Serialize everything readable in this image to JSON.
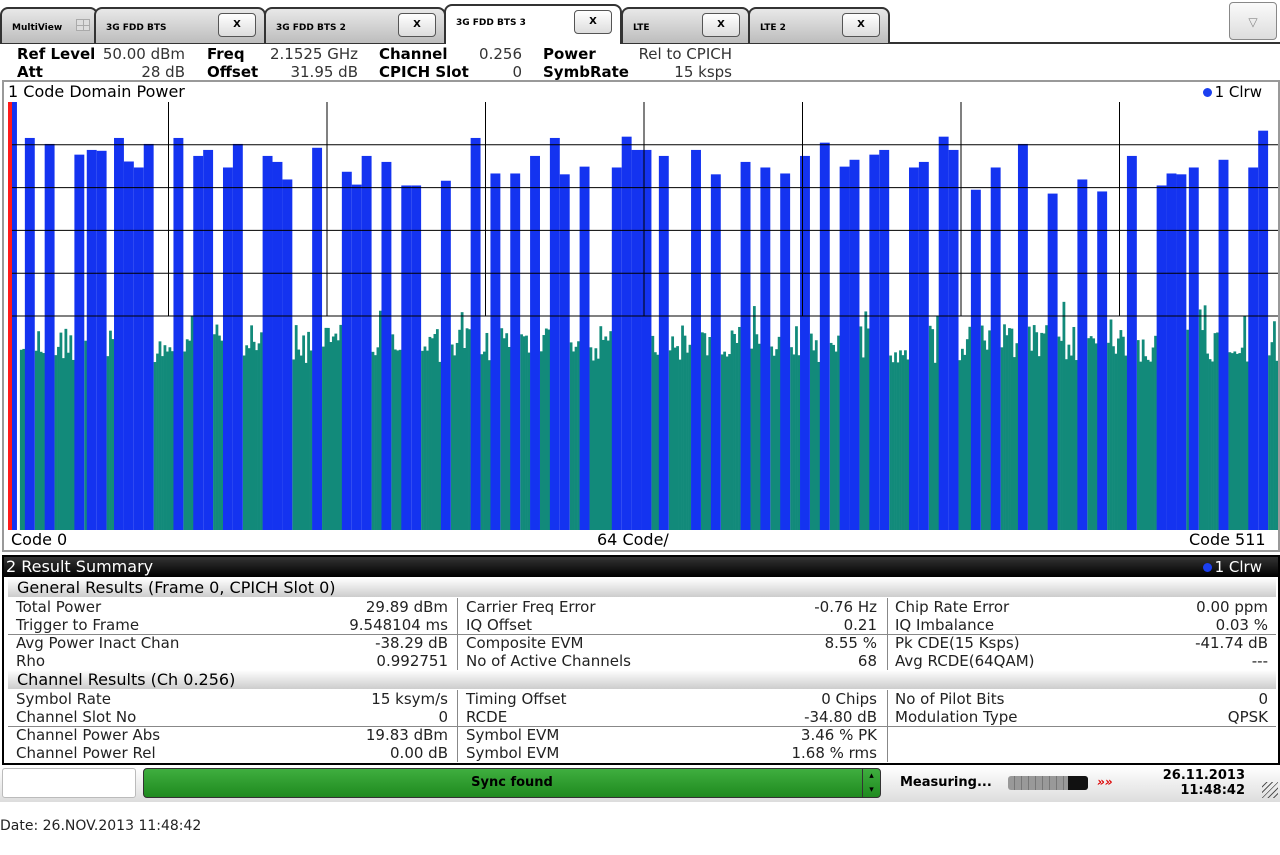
{
  "tabs": [
    {
      "label": "MultiView",
      "icon": "multiview-grid-icon",
      "close": ""
    },
    {
      "label": "3G FDD BTS",
      "close": "X"
    },
    {
      "label": "3G FDD BTS 2",
      "close": "X"
    },
    {
      "label": "3G FDD BTS 3",
      "close": "X",
      "active": true
    },
    {
      "label": "LTE",
      "close": "X"
    },
    {
      "label": "LTE 2",
      "close": "X"
    }
  ],
  "menu_icon": "▽",
  "header": {
    "ref_level_label": "Ref Level",
    "ref_level": "50.00 dBm",
    "att_label": "Att",
    "att": "28 dB",
    "freq_label": "Freq",
    "freq": "2.1525 GHz",
    "offset_label": "Offset",
    "offset": "31.95 dB",
    "channel_label": "Channel",
    "channel": "0.256",
    "cpich_label": "CPICH Slot",
    "cpich": "0",
    "power_label": "Power",
    "power": "Rel to CPICH",
    "symbrate_label": "SymbRate",
    "symbrate": "15 ksps"
  },
  "panel1": {
    "title": "1 Code Domain Power",
    "trace": "1 Clrw",
    "x_left": "Code 0",
    "x_center": "64 Code/",
    "x_right": "Code 511"
  },
  "chart_data": {
    "type": "bar",
    "xlabel": "64 Code/",
    "xlim": [
      0,
      511
    ],
    "ylim": [
      -100,
      0
    ],
    "grid": true,
    "colors": {
      "active": "#1433f0",
      "inactive": "#128a7a",
      "selected": "#ff1a1a"
    },
    "active_channels": [
      {
        "code": 0,
        "db": 0
      },
      {
        "code": 6,
        "db": -8.4
      },
      {
        "code": 14,
        "db": -9.8
      },
      {
        "code": 26,
        "db": -12.3
      },
      {
        "code": 31,
        "db": -11.2
      },
      {
        "code": 35,
        "db": -11.4
      },
      {
        "code": 42,
        "db": -8.4
      },
      {
        "code": 46,
        "db": -13.9
      },
      {
        "code": 50,
        "db": -15.3
      },
      {
        "code": 54,
        "db": -9.8
      },
      {
        "code": 66,
        "db": -8.4
      },
      {
        "code": 74,
        "db": -12.6
      },
      {
        "code": 78,
        "db": -11.2
      },
      {
        "code": 86,
        "db": -15.3
      },
      {
        "code": 90,
        "db": -9.8
      },
      {
        "code": 102,
        "db": -12.6
      },
      {
        "code": 106,
        "db": -14.0
      },
      {
        "code": 110,
        "db": -18.1
      },
      {
        "code": 122,
        "db": -10.7
      },
      {
        "code": 134,
        "db": -16.3
      },
      {
        "code": 138,
        "db": -19.3
      },
      {
        "code": 142,
        "db": -12.6
      },
      {
        "code": 150,
        "db": -14.0
      },
      {
        "code": 158,
        "db": -19.5
      },
      {
        "code": 162,
        "db": -19.5
      },
      {
        "code": 174,
        "db": -18.4
      },
      {
        "code": 186,
        "db": -8.4
      },
      {
        "code": 194,
        "db": -16.7
      },
      {
        "code": 202,
        "db": -16.7
      },
      {
        "code": 210,
        "db": -12.6
      },
      {
        "code": 218,
        "db": -8.4
      },
      {
        "code": 222,
        "db": -16.9
      },
      {
        "code": 230,
        "db": -15.1
      },
      {
        "code": 243,
        "db": -15.3
      },
      {
        "code": 247,
        "db": -8.1
      },
      {
        "code": 251,
        "db": -11.2
      },
      {
        "code": 255,
        "db": -11.2
      },
      {
        "code": 262,
        "db": -12.6
      },
      {
        "code": 275,
        "db": -11.2
      },
      {
        "code": 283,
        "db": -16.9
      },
      {
        "code": 295,
        "db": -14.0
      },
      {
        "code": 303,
        "db": -15.3
      },
      {
        "code": 311,
        "db": -16.7
      },
      {
        "code": 319,
        "db": -12.6
      },
      {
        "code": 327,
        "db": -9.5
      },
      {
        "code": 335,
        "db": -15.1
      },
      {
        "code": 339,
        "db": -13.5
      },
      {
        "code": 347,
        "db": -12.3
      },
      {
        "code": 351,
        "db": -11.2
      },
      {
        "code": 363,
        "db": -15.3
      },
      {
        "code": 367,
        "db": -14.0
      },
      {
        "code": 375,
        "db": -8.1
      },
      {
        "code": 379,
        "db": -11.2
      },
      {
        "code": 388,
        "db": -20.5
      },
      {
        "code": 396,
        "db": -15.3
      },
      {
        "code": 407,
        "db": -9.8
      },
      {
        "code": 419,
        "db": -21.4
      },
      {
        "code": 431,
        "db": -18.1
      },
      {
        "code": 439,
        "db": -20.9
      },
      {
        "code": 451,
        "db": -12.6
      },
      {
        "code": 463,
        "db": -19.5
      },
      {
        "code": 467,
        "db": -16.7
      },
      {
        "code": 471,
        "db": -16.9
      },
      {
        "code": 476,
        "db": -15.3
      },
      {
        "code": 488,
        "db": -13.5
      },
      {
        "code": 500,
        "db": -15.3
      },
      {
        "code": 504,
        "db": -6.7
      }
    ]
  },
  "panel2": {
    "title": "2 Result Summary",
    "trace": "1 Clrw",
    "general_title": "General Results (Frame 0, CPICH Slot 0)",
    "general_rows": [
      [
        [
          "Total Power",
          "29.89 dBm"
        ],
        [
          "Carrier Freq Error",
          "-0.76 Hz"
        ],
        [
          "Chip Rate Error",
          "0.00 ppm"
        ]
      ],
      [
        [
          "Trigger to Frame",
          "9.548104 ms"
        ],
        [
          "IQ Offset",
          "0.21"
        ],
        [
          "IQ Imbalance",
          "0.03 %"
        ]
      ],
      [
        [
          "Avg Power Inact Chan",
          "-38.29 dB"
        ],
        [
          "Composite EVM",
          "8.55 %"
        ],
        [
          "Pk CDE(15 Ksps)",
          "-41.74 dB"
        ]
      ],
      [
        [
          "Rho",
          "0.992751"
        ],
        [
          "No of Active Channels",
          "68"
        ],
        [
          "Avg RCDE(64QAM)",
          "---"
        ]
      ]
    ],
    "channel_title": "Channel Results (Ch 0.256)",
    "channel_rows": [
      [
        [
          "Symbol Rate",
          "15 ksym/s"
        ],
        [
          "Timing Offset",
          "0 Chips"
        ],
        [
          "No of Pilot Bits",
          "0"
        ]
      ],
      [
        [
          "Channel Slot No",
          "0"
        ],
        [
          "RCDE",
          "-34.80 dB"
        ],
        [
          "Modulation Type",
          "QPSK"
        ]
      ],
      [
        [
          "Channel Power Abs",
          "19.83 dBm"
        ],
        [
          "Symbol EVM",
          "3.46 % PK"
        ],
        [
          "",
          ""
        ]
      ],
      [
        [
          "Channel Power Rel",
          "0.00 dB"
        ],
        [
          "Symbol EVM",
          "1.68 % rms"
        ],
        [
          "",
          ""
        ]
      ]
    ]
  },
  "status": {
    "input_value": "",
    "sync": "Sync found",
    "measuring": "Measuring...",
    "progress": 0.75,
    "date": "26.11.2013",
    "time": "11:48:42"
  },
  "footer": "Date: 26.NOV.2013  11:48:42"
}
